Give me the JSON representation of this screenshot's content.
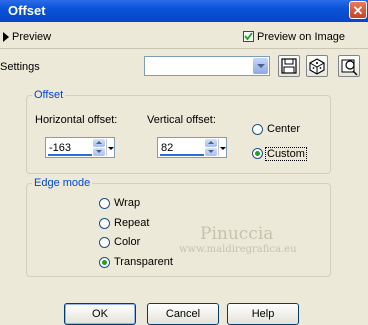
{
  "window": {
    "title": "Offset",
    "close_glyph": "✕"
  },
  "preview": {
    "label": "Preview",
    "preview_on_image_label": "Preview on Image",
    "preview_on_image_checked": true
  },
  "settings": {
    "label": "Settings",
    "value": ""
  },
  "offset": {
    "legend": "Offset",
    "horizontal_label": "Horizontal offset:",
    "horizontal_value": "-163",
    "vertical_label": "Vertical offset:",
    "vertical_value": "82",
    "center_label": "Center",
    "custom_label": "Custom",
    "selected": "Custom"
  },
  "edge_mode": {
    "legend": "Edge mode",
    "options": [
      "Wrap",
      "Repeat",
      "Color",
      "Transparent"
    ],
    "selected": "Transparent"
  },
  "watermark": {
    "name": "Pinuccia",
    "site": "www.maldiregrafica.eu"
  },
  "buttons": {
    "ok": "OK",
    "cancel": "Cancel",
    "help": "Help"
  },
  "colors": {
    "titlebar": "#0a53d8",
    "group_legend": "#0046d5",
    "radio_selected": "#21a121"
  }
}
